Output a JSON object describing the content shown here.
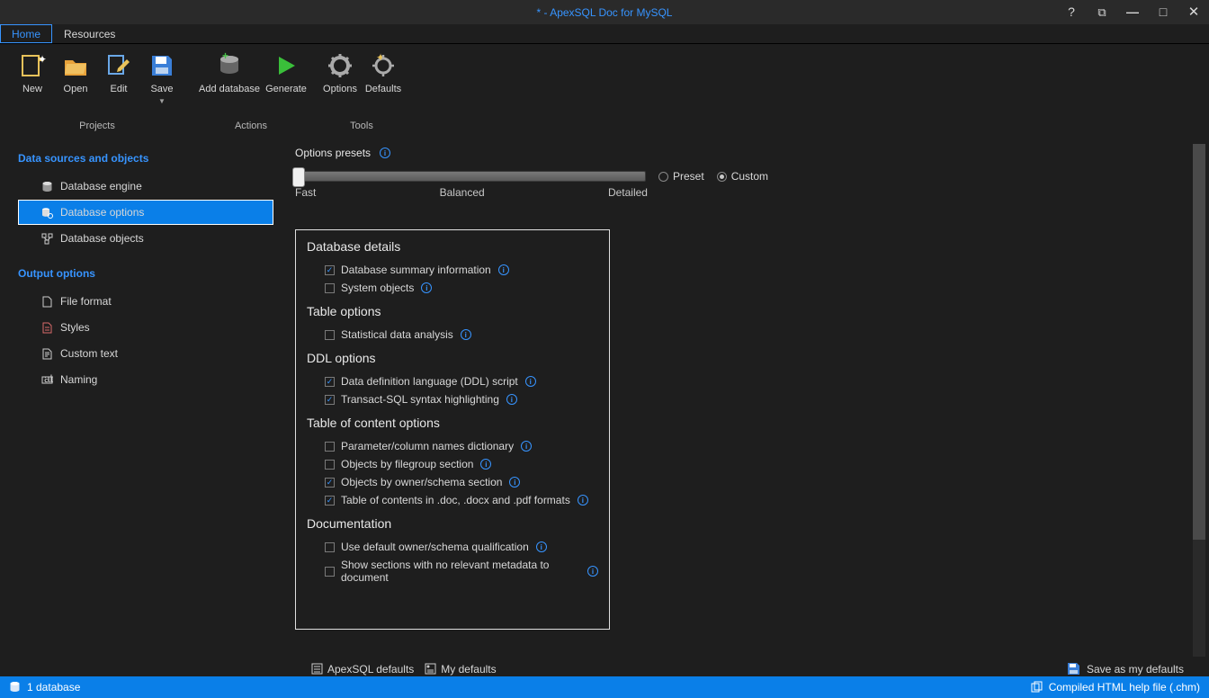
{
  "titlebar": {
    "title": "* - ApexSQL Doc for MySQL"
  },
  "tabs": {
    "home": "Home",
    "resources": "Resources"
  },
  "ribbon": {
    "projects": {
      "label": "Projects",
      "new": "New",
      "open": "Open",
      "edit": "Edit",
      "save": "Save"
    },
    "actions": {
      "label": "Actions",
      "add": "Add database",
      "generate": "Generate"
    },
    "tools": {
      "label": "Tools",
      "options": "Options",
      "defaults": "Defaults"
    }
  },
  "sidebar": {
    "head1": "Data sources and objects",
    "engine": "Database engine",
    "dboptions": "Database options",
    "dbobjects": "Database objects",
    "head2": "Output options",
    "fileformat": "File format",
    "styles": "Styles",
    "customtext": "Custom text",
    "naming": "Naming"
  },
  "main": {
    "presets_title": "Options presets",
    "fast": "Fast",
    "balanced": "Balanced",
    "detailed": "Detailed",
    "preset": "Preset",
    "custom": "Custom",
    "sec_dbdetails": "Database details",
    "opt_summary": "Database summary information",
    "opt_sysobj": "System objects",
    "sec_tableopt": "Table options",
    "opt_statdata": "Statistical data analysis",
    "sec_ddl": "DDL options",
    "opt_ddlscript": "Data definition language (DDL) script",
    "opt_tsqlhl": "Transact-SQL syntax highlighting",
    "sec_toc": "Table of content options",
    "opt_paramdict": "Parameter/column names dictionary",
    "opt_filegroup": "Objects by filegroup section",
    "opt_ownerschema": "Objects by owner/schema section",
    "opt_tocformats": "Table of contents in .doc, .docx and .pdf formats",
    "sec_documentation": "Documentation",
    "opt_defowner": "Use default owner/schema qualification",
    "opt_showsections": "Show sections with no relevant metadata to document",
    "apexsql_defaults": "ApexSQL defaults",
    "my_defaults": "My defaults",
    "save_defaults": "Save as my defaults"
  },
  "statusbar": {
    "left": "1 database",
    "right": "Compiled HTML help file (.chm)"
  }
}
